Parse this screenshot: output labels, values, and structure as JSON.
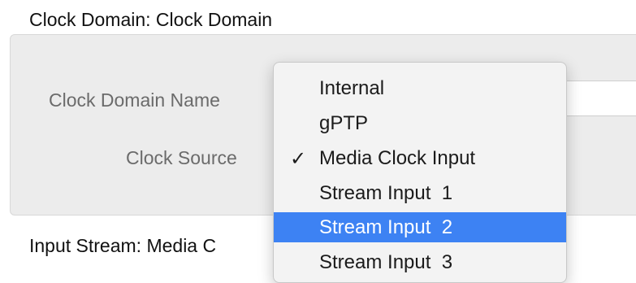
{
  "clock_domain_section": {
    "title": "Clock Domain: Clock Domain",
    "name_label": "Clock Domain Name",
    "source_label": "Clock Source"
  },
  "input_stream_section": {
    "title": "Input Stream: Media C"
  },
  "clock_source_menu": {
    "items": [
      {
        "label": "Internal",
        "checked": false,
        "highlighted": false
      },
      {
        "label": "gPTP",
        "checked": false,
        "highlighted": false
      },
      {
        "label": "Media Clock Input",
        "checked": true,
        "highlighted": false
      },
      {
        "label": "Stream Input  1",
        "checked": false,
        "highlighted": false
      },
      {
        "label": "Stream Input  2",
        "checked": false,
        "highlighted": true
      },
      {
        "label": "Stream Input  3",
        "checked": false,
        "highlighted": false
      }
    ],
    "check_mark": "✓",
    "highlight_color": "#3d82f3"
  }
}
